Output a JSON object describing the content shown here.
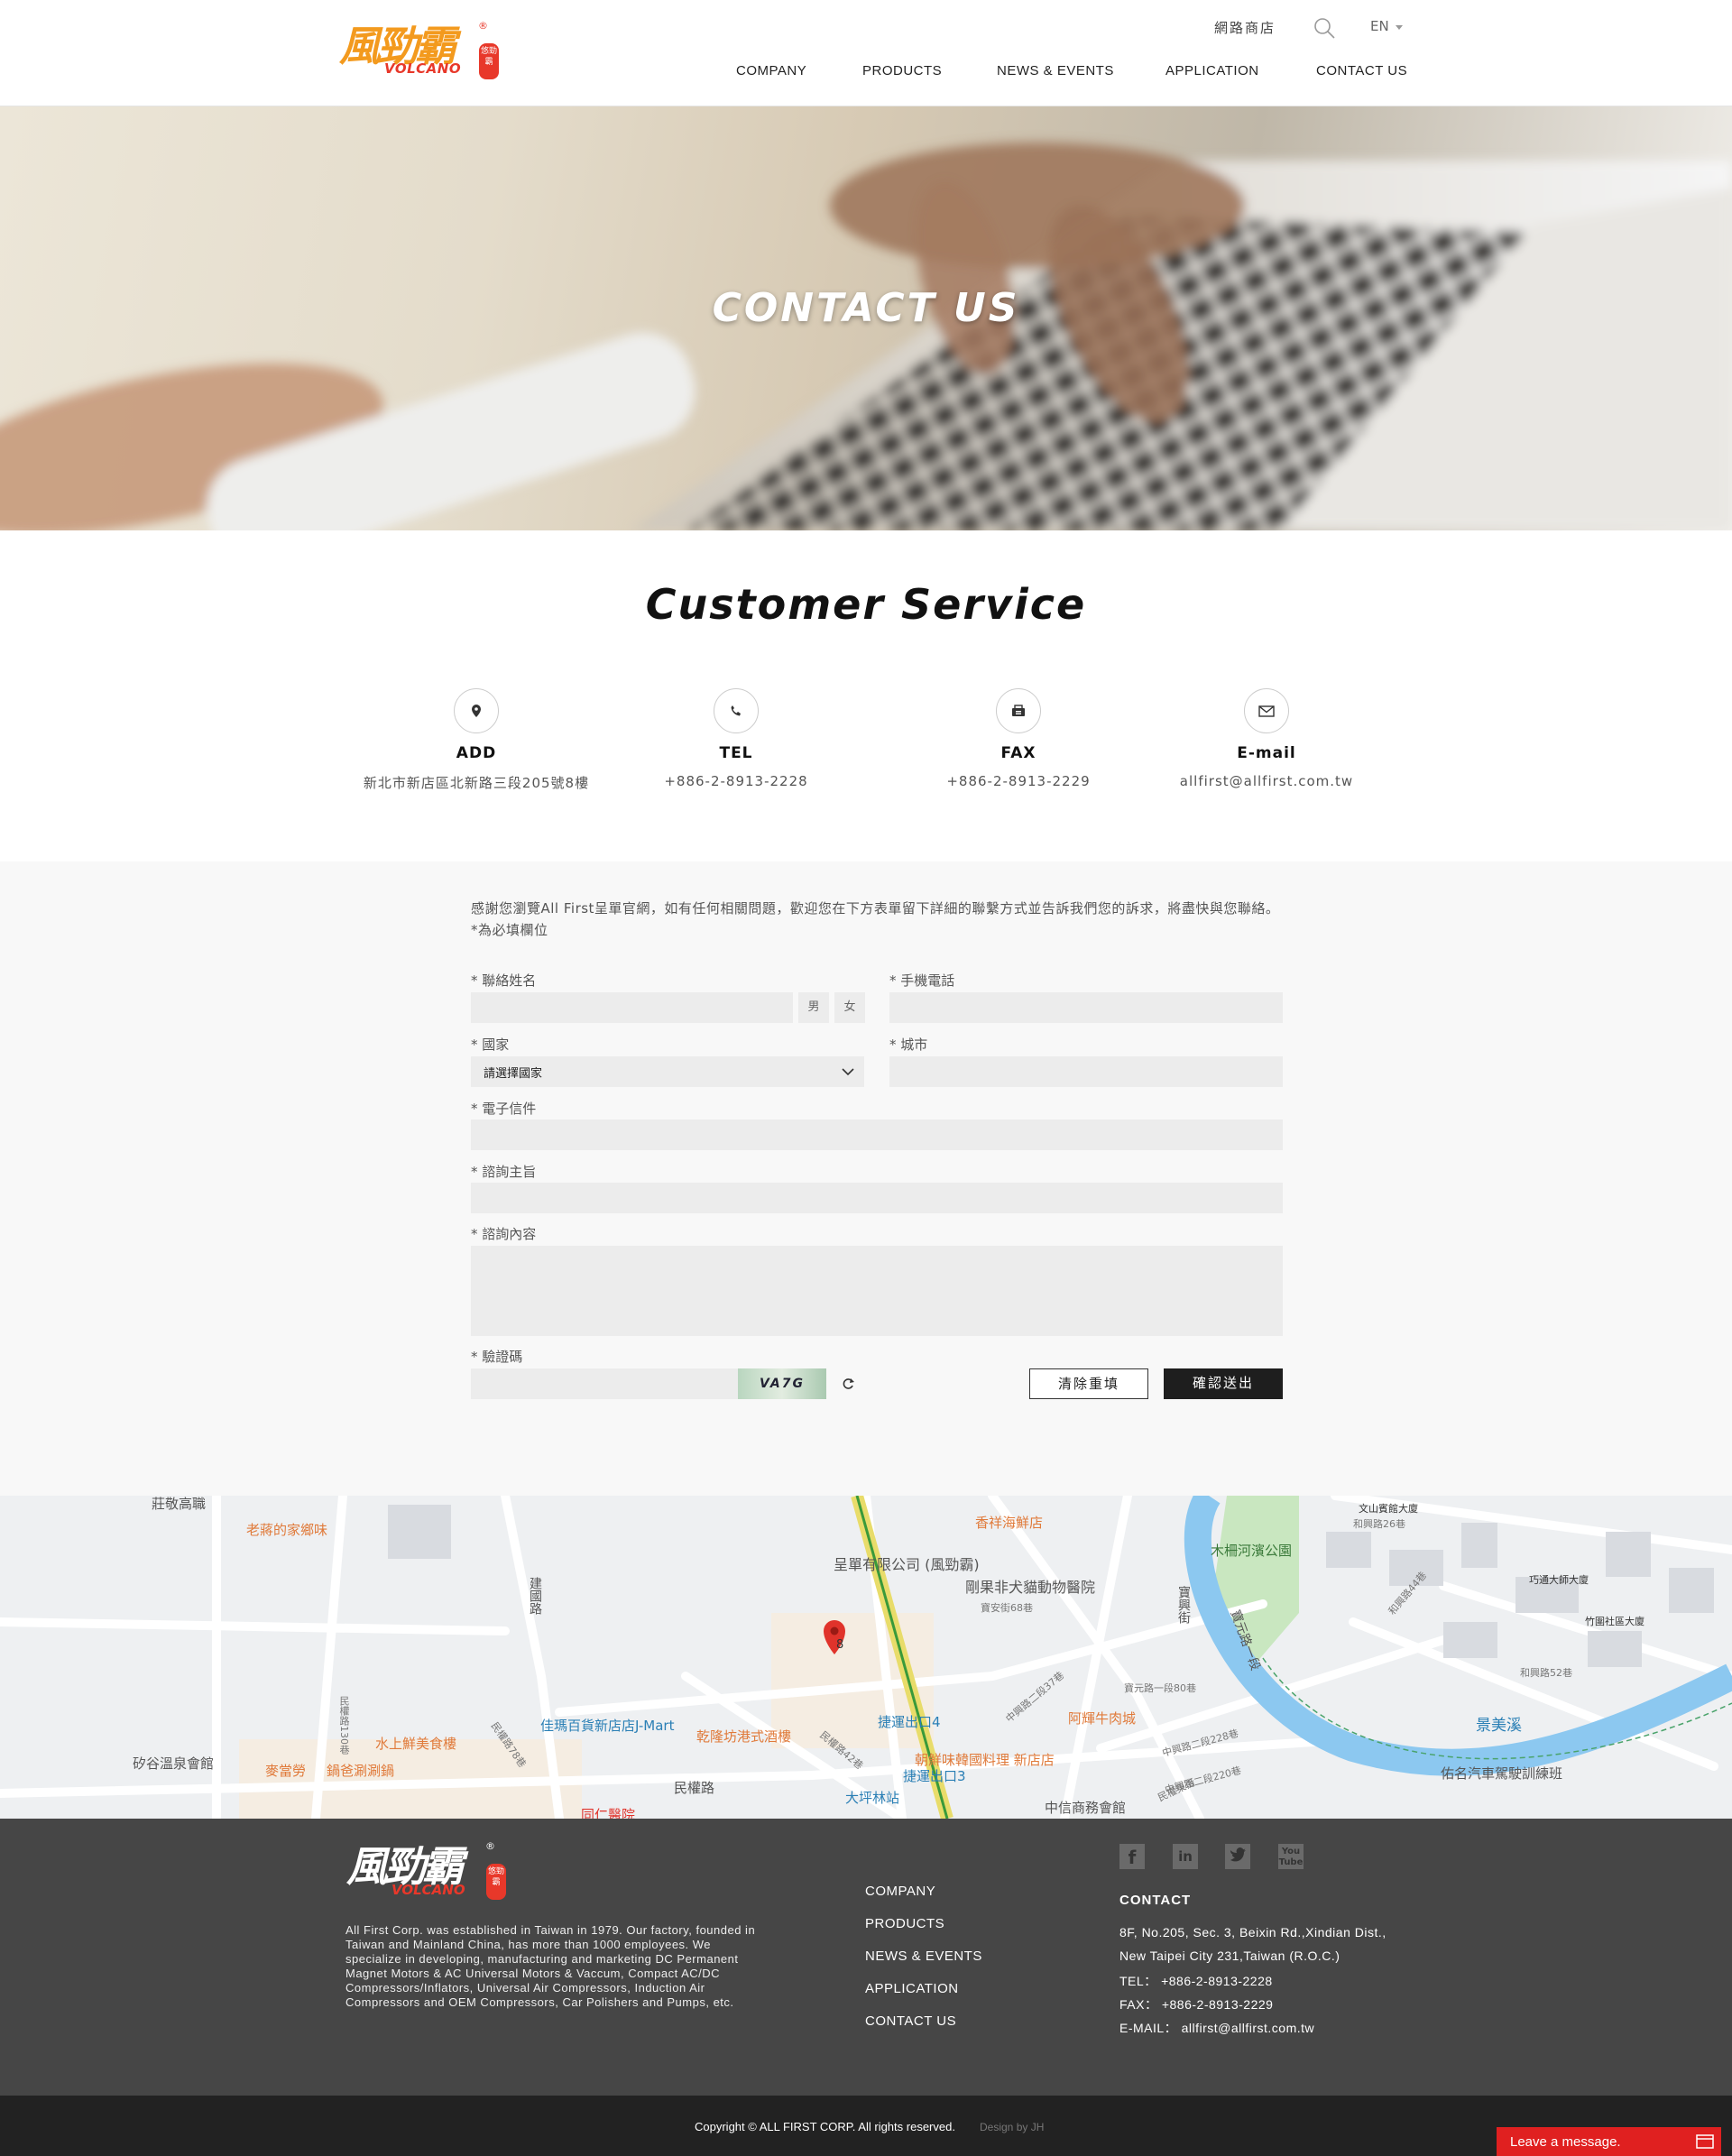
{
  "header": {
    "logo_zh": "風勁霸",
    "logo_en": "VOLCANO",
    "logo_seal": "悠勁霸",
    "logo_reg": "®",
    "shop_label": "網路商店",
    "lang_label": "EN",
    "nav": [
      "COMPANY",
      "PRODUCTS",
      "NEWS & EVENTS",
      "APPLICATION",
      "CONTACT US"
    ]
  },
  "hero": {
    "title": "CONTACT US"
  },
  "customer_service": {
    "title": "Customer Service",
    "items": [
      {
        "icon": "location-pin-icon",
        "label": "ADD",
        "value": "新北市新店區北新路三段205號8樓"
      },
      {
        "icon": "phone-icon",
        "label": "TEL",
        "value": "+886-2-8913-2228"
      },
      {
        "icon": "fax-icon",
        "label": "FAX",
        "value": "+886-2-8913-2229"
      },
      {
        "icon": "mail-icon",
        "label": "E-mail",
        "value": "allfirst@allfirst.com.tw"
      }
    ]
  },
  "form": {
    "intro": "感謝您瀏覽All First呈單官網，如有任何相關問題，歡迎您在下方表單留下詳細的聯繫方式並告訴我們您的訴求，將盡快與您聯絡。   *為必填欄位",
    "name_label": "*  聯絡姓名",
    "male": "男",
    "female": "女",
    "mobile_label": "*  手機電話",
    "country_label": "*  國家",
    "country_selected": "請選擇國家",
    "city_label": "*  城市",
    "email_label": "*  電子信件",
    "subject_label": "*  諮詢主旨",
    "content_label": "*  諮詢內容",
    "captcha_label": "*  驗證碼",
    "captcha_code": "VA7G",
    "reset_button": "清除重填",
    "submit_button": "確認送出",
    "accent_color": "#1e1e1e"
  },
  "map": {
    "labels": [
      "莊敬高職",
      "老蔣的家鄉味",
      "呈單有限公司 (風勁霸)",
      "香祥海鮮店",
      "剛果非犬貓動物醫院",
      "寶安街68巷",
      "木柵河濱公園",
      "文山賓館大廈",
      "和興路26巷",
      "巧通大師大廈",
      "竹圍社區大廈",
      "和興路44巷",
      "和興路52巷",
      "捷運出口4",
      "中興路二段37巷",
      "阿輝牛肉城",
      "景美溪",
      "佑名汽車駕駛訓練班",
      "佳瑪百貨新店店J-Mart",
      "乾隆坊港式酒樓",
      "朝鮮味韓國料理 新店店",
      "捷運出口3",
      "大坪林站",
      "中信商務會館",
      "中興路二段228巷",
      "中興路二段220巷",
      "水上鮮美食樓",
      "麥當勞",
      "鍋爸涮涮鍋",
      "矽谷溫泉會館",
      "民權路",
      "建國路",
      "寶元路一段80巷",
      "寶興街",
      "寶元路一段",
      "民權路130巷",
      "民權東街",
      "8",
      "同仁醫院",
      "民權路42巷",
      "民權路78巷"
    ]
  },
  "footer": {
    "about": "All First Corp. was established in Taiwan in 1979. Our factory, founded in Taiwan and Mainland China, has more than 1000 employees. We specialize in developing, manufacturing and marketing DC Permanent Magnet Motors & AC Universal Motors & Vaccum, Compact AC/DC Compressors/Inflators, Universal Air Compressors, Induction Air Compressors and OEM Compressors, Car Polishers and Pumps, etc.",
    "links": [
      "COMPANY",
      "PRODUCTS",
      "NEWS & EVENTS",
      "APPLICATION",
      "CONTACT US"
    ],
    "social": [
      "facebook-icon",
      "linkedin-icon",
      "twitter-icon",
      "youtube-icon"
    ],
    "contact_title": "CONTACT",
    "address1": "8F, No.205, Sec. 3, Beixin Rd.,Xindian Dist.,",
    "address2": "New Taipei City 231,Taiwan (R.O.C.)",
    "tel": "TEL：  +886-2-8913-2228",
    "fax": "FAX：  +886-2-8913-2229",
    "email": "E-MAIL：  allfirst@allfirst.com.tw"
  },
  "bottom": {
    "copyright": "Copyright © ALL FIRST CORP. All rights reserved.",
    "design": "Design by JH",
    "chat": "Leave a message.",
    "chat_color": "#e02020"
  }
}
